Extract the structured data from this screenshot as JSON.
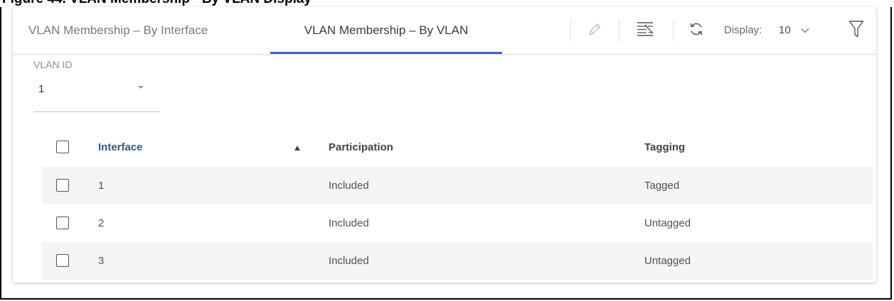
{
  "caption": "Figure 44. VLAN Membership - By VLAN Display",
  "tabs": [
    {
      "label": "VLAN Membership – By Interface"
    },
    {
      "label": "VLAN Membership – By VLAN"
    }
  ],
  "toolbar": {
    "edit_icon": "pencil-icon",
    "columns_icon": "column-toggle-icon",
    "refresh_icon": "refresh-icon",
    "display_label": "Display:",
    "display_value": "10",
    "filter_icon": "filter-icon"
  },
  "vlan_filter": {
    "label": "VLAN ID",
    "value": "1"
  },
  "table": {
    "columns": [
      "Interface",
      "Participation",
      "Tagging"
    ],
    "sort_column": "Interface",
    "sort_direction": "ascending",
    "rows": [
      {
        "interface": "1",
        "participation": "Included",
        "tagging": "Tagged"
      },
      {
        "interface": "2",
        "participation": "Included",
        "tagging": "Untagged"
      },
      {
        "interface": "3",
        "participation": "Included",
        "tagging": "Untagged"
      }
    ]
  },
  "colors": {
    "accent": "#3a64c9",
    "header_link": "#2c5a8a",
    "row_shade": "#f5f5f5"
  }
}
